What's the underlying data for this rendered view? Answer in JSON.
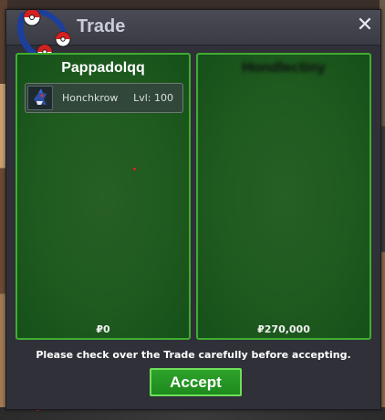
{
  "window": {
    "title": "Trade",
    "close_label": "✕"
  },
  "left_panel": {
    "player_name": "Pappadolqq",
    "items": [
      {
        "icon": "honchkrow-icon",
        "name": "Honchkrow",
        "level": "Lvl: 100"
      }
    ],
    "money": "₽0"
  },
  "right_panel": {
    "player_name": "Hondlectiny",
    "items": [],
    "money": "₽270,000"
  },
  "notice": "Please check over the Trade carefully before accepting.",
  "accept_label": "Accept",
  "colors": {
    "panel_border": "#3eae2e",
    "accept": "#2ea22a"
  }
}
